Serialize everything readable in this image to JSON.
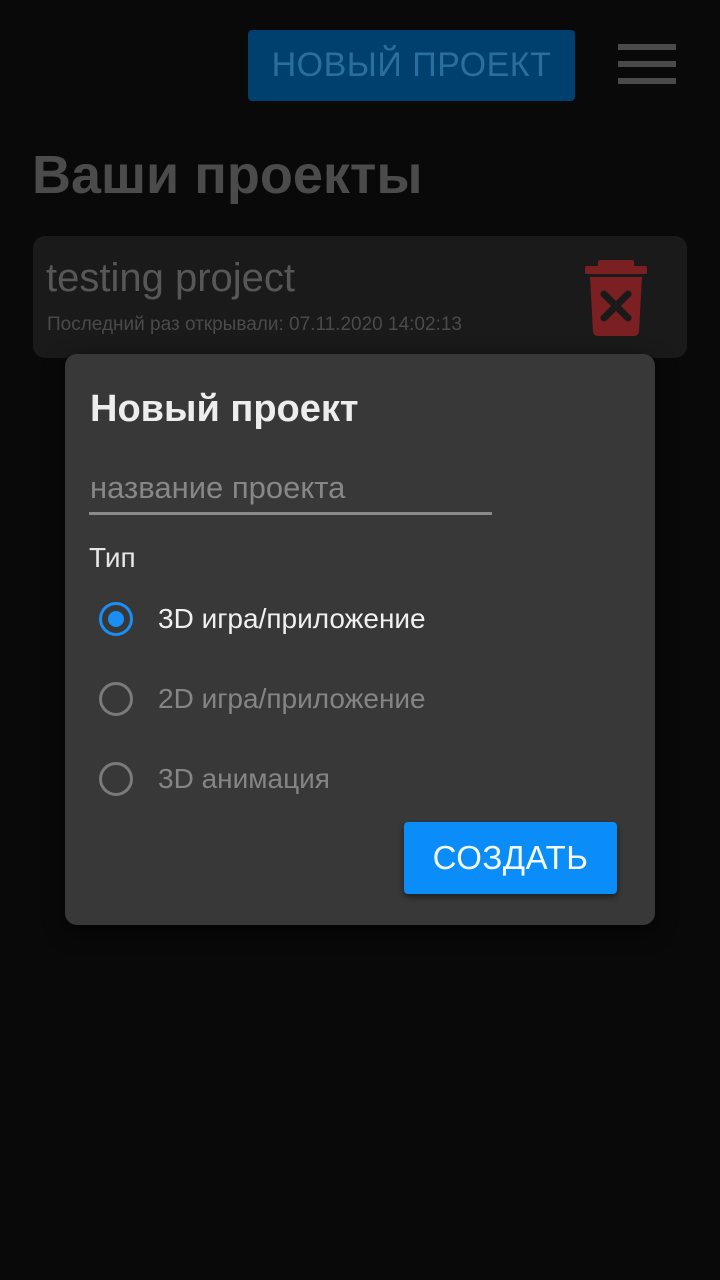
{
  "header": {
    "new_project_button": "НОВЫЙ ПРОЕКТ",
    "menu_icon": "hamburger-menu-icon"
  },
  "main": {
    "title": "Ваши проекты",
    "projects": [
      {
        "name": "testing project",
        "last_opened": "Последний раз открывали: 07.11.2020 14:02:13",
        "delete_icon": "trash-icon"
      }
    ]
  },
  "dialog": {
    "title": "Новый проект",
    "name_input": {
      "placeholder": "название проекта",
      "value": ""
    },
    "type_label": "Тип",
    "types": [
      {
        "label": "3D игра/приложение",
        "selected": true
      },
      {
        "label": "2D игра/приложение",
        "selected": false
      },
      {
        "label": "3D анимация",
        "selected": false
      }
    ],
    "create_button": "СОЗДАТЬ"
  },
  "colors": {
    "background": "#090909",
    "dialog_background": "#383838",
    "accent": "#0a8df8",
    "delete_icon": "#7a1f22"
  }
}
